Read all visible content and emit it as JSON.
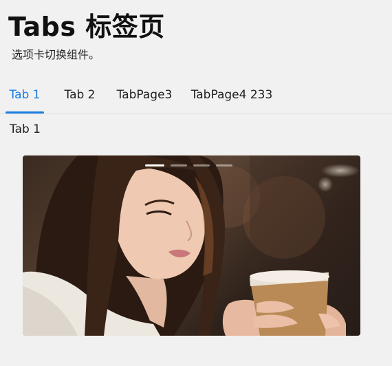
{
  "page": {
    "title": "Tabs 标签页",
    "subtitle": "选项卡切换组件。"
  },
  "tabs": [
    {
      "label": "Tab 1",
      "active": true
    },
    {
      "label": "Tab 2",
      "active": false
    },
    {
      "label": "TabPage3",
      "active": false
    },
    {
      "label": "TabPage4 233",
      "active": false
    }
  ],
  "panel": {
    "label": "Tab 1"
  },
  "carousel": {
    "slide_count": 4,
    "active_index": 0
  },
  "colors": {
    "accent": "#1a7ce0",
    "background": "#f1f1f1"
  }
}
